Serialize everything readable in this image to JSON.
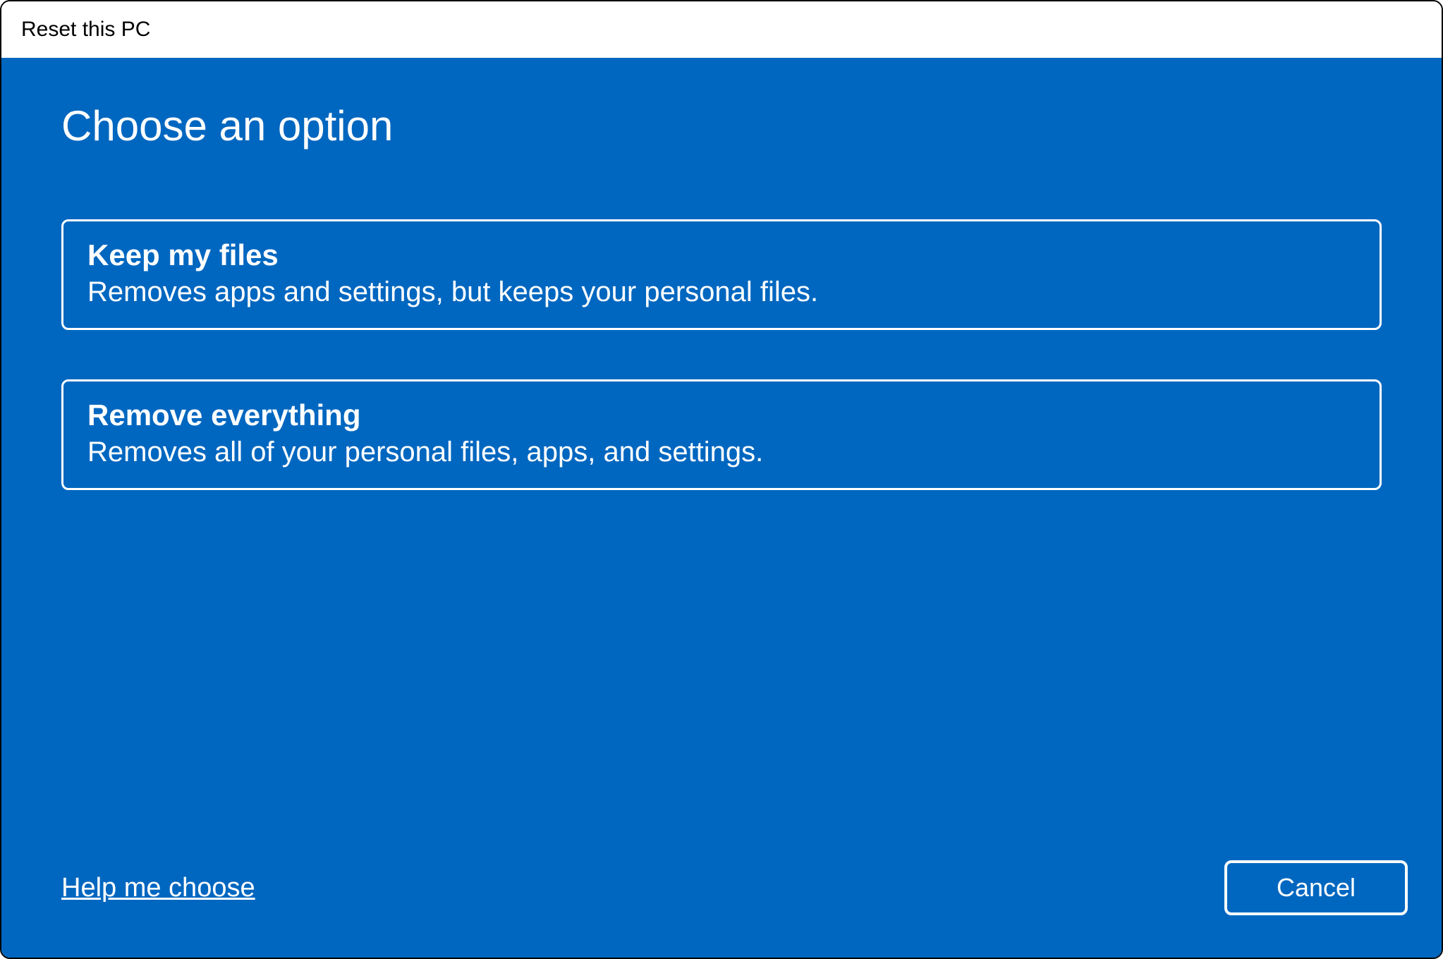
{
  "titlebar": {
    "title": "Reset this PC"
  },
  "main": {
    "heading": "Choose an option",
    "options": [
      {
        "title": "Keep my files",
        "description": "Removes apps and settings, but keeps your personal files."
      },
      {
        "title": "Remove everything",
        "description": "Removes all of your personal files, apps, and settings."
      }
    ]
  },
  "footer": {
    "help_link": "Help me choose",
    "cancel_label": "Cancel"
  }
}
